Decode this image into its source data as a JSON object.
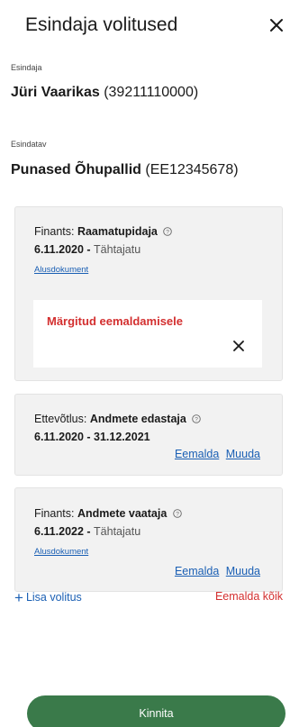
{
  "dialog": {
    "title": "Esindaja volitused",
    "close_icon": "close-icon"
  },
  "representative": {
    "label": "Esindaja",
    "name": "Jüri Vaarikas",
    "id": "(39211110000)"
  },
  "represented": {
    "label": "Esindatav",
    "name": "Punased Õhupallid",
    "id": "(EE12345678)"
  },
  "mandates": [
    {
      "domain": "Finants:",
      "role": "Raamatupidaja",
      "date_start": "6.11.2020",
      "date_end": "Tähtajatu",
      "document_link": "Alusdokument",
      "marked_notice": "Märgitud eemaldamisele"
    },
    {
      "domain": "Ettevõtlus:",
      "role": "Andmete edastaja",
      "date_start": "6.11.2020",
      "date_end": "31.12.2021",
      "remove_label": "Eemalda",
      "edit_label": "Muuda"
    },
    {
      "domain": "Finants:",
      "role": "Andmete vaataja",
      "date_start": "6.11.2022",
      "date_end": "Tähtajatu",
      "document_link": "Alusdokument",
      "remove_label": "Eemalda",
      "edit_label": "Muuda"
    }
  ],
  "footer": {
    "add_label": "Lisa volitus",
    "remove_all_label": "Eemalda kõik",
    "confirm_label": "Kinnita"
  },
  "colors": {
    "link": "#1a5fb4",
    "danger": "#d32f2f",
    "primary": "#3a7a4a",
    "card_bg": "#f2f2f2"
  }
}
